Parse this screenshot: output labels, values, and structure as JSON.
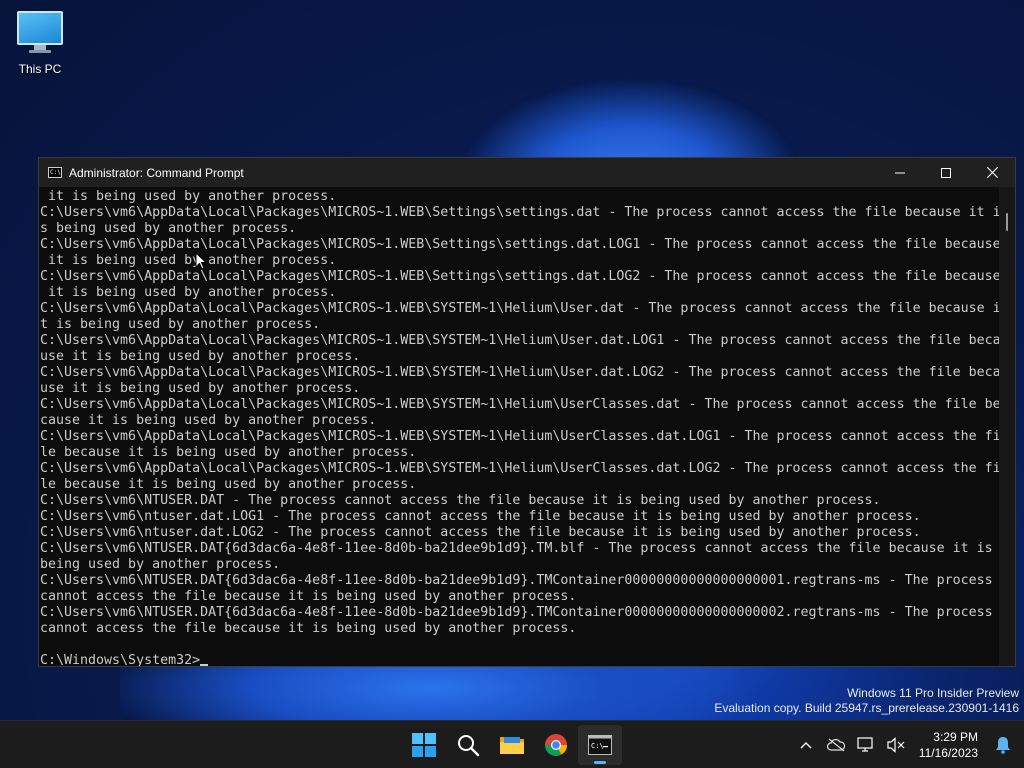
{
  "desktop": {
    "icon_label": "This PC"
  },
  "window": {
    "title": "Administrator: Command Prompt",
    "minimize_label": "Minimize",
    "maximize_label": "Maximize",
    "close_label": "Close"
  },
  "console": {
    "lines": [
      " it is being used by another process.",
      "C:\\Users\\vm6\\AppData\\Local\\Packages\\MICROS~1.WEB\\Settings\\settings.dat - The process cannot access the file because it i",
      "s being used by another process.",
      "C:\\Users\\vm6\\AppData\\Local\\Packages\\MICROS~1.WEB\\Settings\\settings.dat.LOG1 - The process cannot access the file because",
      " it is being used by another process.",
      "C:\\Users\\vm6\\AppData\\Local\\Packages\\MICROS~1.WEB\\Settings\\settings.dat.LOG2 - The process cannot access the file because",
      " it is being used by another process.",
      "C:\\Users\\vm6\\AppData\\Local\\Packages\\MICROS~1.WEB\\SYSTEM~1\\Helium\\User.dat - The process cannot access the file because i",
      "t is being used by another process.",
      "C:\\Users\\vm6\\AppData\\Local\\Packages\\MICROS~1.WEB\\SYSTEM~1\\Helium\\User.dat.LOG1 - The process cannot access the file beca",
      "use it is being used by another process.",
      "C:\\Users\\vm6\\AppData\\Local\\Packages\\MICROS~1.WEB\\SYSTEM~1\\Helium\\User.dat.LOG2 - The process cannot access the file beca",
      "use it is being used by another process.",
      "C:\\Users\\vm6\\AppData\\Local\\Packages\\MICROS~1.WEB\\SYSTEM~1\\Helium\\UserClasses.dat - The process cannot access the file be",
      "cause it is being used by another process.",
      "C:\\Users\\vm6\\AppData\\Local\\Packages\\MICROS~1.WEB\\SYSTEM~1\\Helium\\UserClasses.dat.LOG1 - The process cannot access the fi",
      "le because it is being used by another process.",
      "C:\\Users\\vm6\\AppData\\Local\\Packages\\MICROS~1.WEB\\SYSTEM~1\\Helium\\UserClasses.dat.LOG2 - The process cannot access the fi",
      "le because it is being used by another process.",
      "C:\\Users\\vm6\\NTUSER.DAT - The process cannot access the file because it is being used by another process.",
      "C:\\Users\\vm6\\ntuser.dat.LOG1 - The process cannot access the file because it is being used by another process.",
      "C:\\Users\\vm6\\ntuser.dat.LOG2 - The process cannot access the file because it is being used by another process.",
      "C:\\Users\\vm6\\NTUSER.DAT{6d3dac6a-4e8f-11ee-8d0b-ba21dee9b1d9}.TM.blf - The process cannot access the file because it is",
      "being used by another process.",
      "C:\\Users\\vm6\\NTUSER.DAT{6d3dac6a-4e8f-11ee-8d0b-ba21dee9b1d9}.TMContainer00000000000000000001.regtrans-ms - The process",
      "cannot access the file because it is being used by another process.",
      "C:\\Users\\vm6\\NTUSER.DAT{6d3dac6a-4e8f-11ee-8d0b-ba21dee9b1d9}.TMContainer00000000000000000002.regtrans-ms - The process",
      "cannot access the file because it is being used by another process.",
      ""
    ],
    "prompt": "C:\\Windows\\System32>"
  },
  "watermark": {
    "line1": "Windows 11 Pro Insider Preview",
    "line2": "Evaluation copy. Build 25947.rs_prerelease.230901-1416"
  },
  "taskbar": {
    "apps": [
      "start-icon",
      "search-icon",
      "file-explorer-icon",
      "chrome-icon",
      "command-prompt-icon"
    ],
    "active_app": "command-prompt-icon",
    "tray_icons": [
      "chevron-up-icon",
      "onedrive-offline-icon",
      "network-icon",
      "volume-muted-icon",
      "notification-bell-icon"
    ],
    "time": "3:29 PM",
    "date": "11/16/2023"
  },
  "colors": {
    "console_bg": "#0c0c0c",
    "console_text": "#cccccc",
    "titlebar_bg": "#202020",
    "taskbar_bg": "#1c1c1c",
    "accent": "#5fb2f2"
  }
}
